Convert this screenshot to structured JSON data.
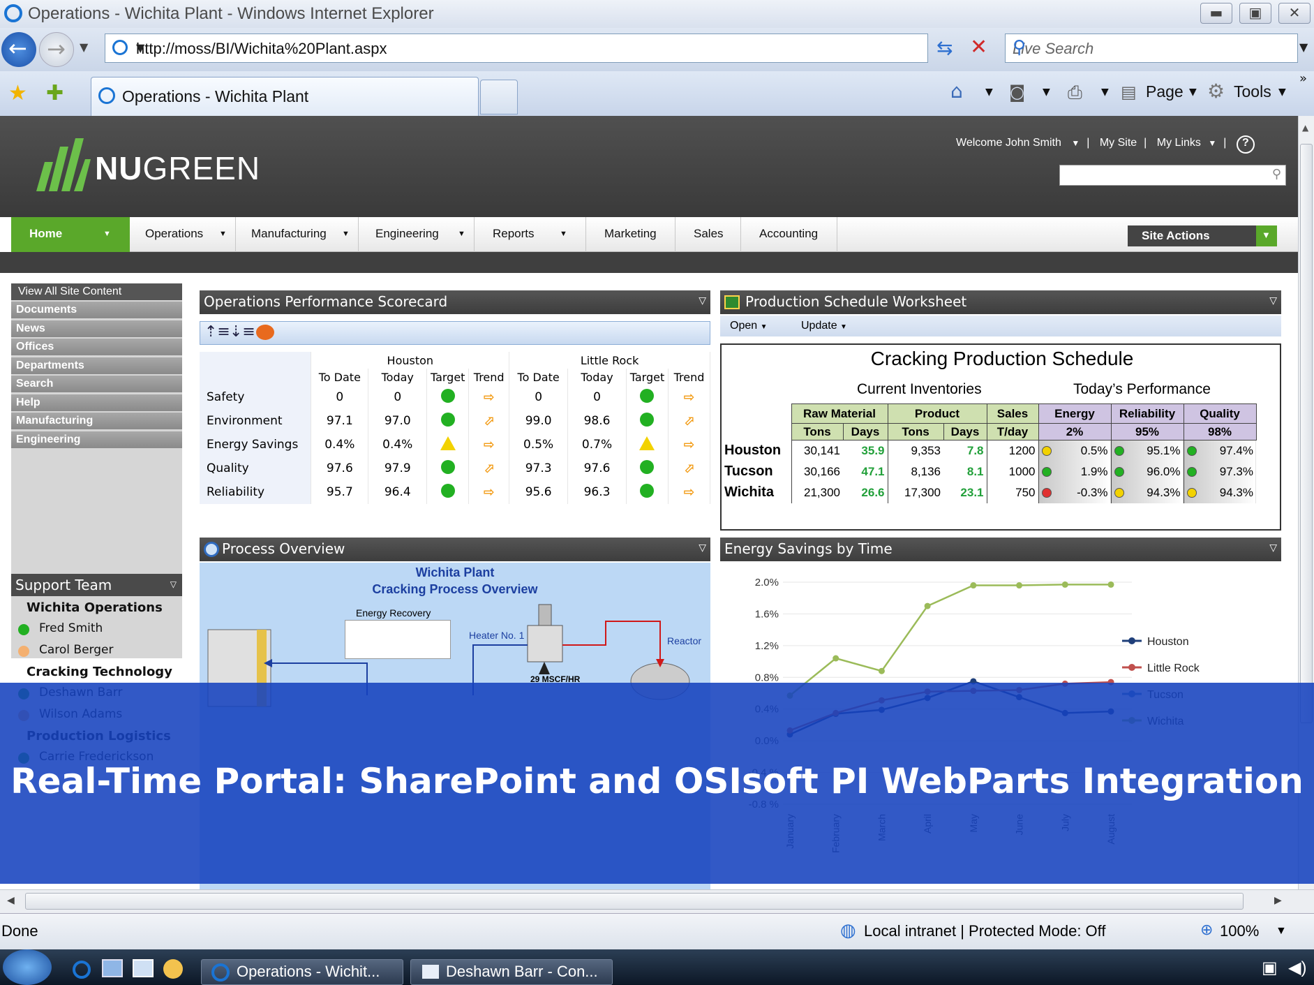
{
  "window": {
    "title": "Operations - Wichita Plant - Windows Internet Explorer"
  },
  "browser": {
    "url": "http://moss/BI/Wichita%20Plant.aspx",
    "search_placeholder": "Live Search",
    "tab_title": "Operations - Wichita Plant",
    "commands": [
      "Page",
      "Tools"
    ]
  },
  "site": {
    "logo_bold": "NU",
    "logo_rest": "GREEN",
    "welcome": "Welcome John Smith",
    "my_site": "My Site",
    "my_links": "My Links",
    "help": "?",
    "nav": [
      "Home",
      "Operations",
      "Manufacturing",
      "Engineering",
      "Reports",
      "Marketing",
      "Sales",
      "Accounting"
    ],
    "site_actions": "Site Actions"
  },
  "quicklaunch": {
    "view_all": "View All Site Content",
    "items": [
      "Documents",
      "News",
      "Offices",
      "Departments",
      "Search",
      "Help",
      "Manufacturing",
      "Engineering"
    ]
  },
  "support_team": {
    "title": "Support Team",
    "groups": [
      {
        "name": "Wichita Operations",
        "people": [
          {
            "name": "Fred Smith",
            "status": "green"
          },
          {
            "name": "Carol Berger",
            "status": "orange"
          }
        ]
      },
      {
        "name": "Cracking Technology",
        "people": [
          {
            "name": "Deshawn Barr",
            "status": "green"
          },
          {
            "name": "Wilson Adams",
            "status": "orange"
          }
        ]
      },
      {
        "name": "Production Logistics",
        "people": [
          {
            "name": "Carrie Frederickson",
            "status": "green"
          }
        ]
      }
    ]
  },
  "scorecard": {
    "title": "Operations Performance Scorecard",
    "regions": [
      "Houston",
      "Little Rock"
    ],
    "columns": [
      "To Date",
      "Today",
      "Target",
      "Trend",
      "To Date",
      "Today",
      "Target",
      "Trend"
    ],
    "rows": [
      {
        "label": "Safety",
        "h_todate": "0",
        "h_today": "0",
        "h_target": "green",
        "h_trend": "right",
        "l_todate": "0",
        "l_today": "0",
        "l_target": "green",
        "l_trend": "right"
      },
      {
        "label": "Environment",
        "h_todate": "97.1",
        "h_today": "97.0",
        "h_target": "green",
        "h_trend": "up",
        "l_todate": "99.0",
        "l_today": "98.6",
        "l_target": "green",
        "l_trend": "up"
      },
      {
        "label": "Energy Savings",
        "h_todate": "0.4%",
        "h_today": "0.4%",
        "h_target": "yellow",
        "h_trend": "right",
        "l_todate": "0.5%",
        "l_today": "0.7%",
        "l_target": "yellow",
        "l_trend": "right"
      },
      {
        "label": "Quality",
        "h_todate": "97.6",
        "h_today": "97.9",
        "h_target": "green",
        "h_trend": "up",
        "l_todate": "97.3",
        "l_today": "97.6",
        "l_target": "green",
        "l_trend": "up"
      },
      {
        "label": "Reliability",
        "h_todate": "95.7",
        "h_today": "96.4",
        "h_target": "green",
        "h_trend": "right",
        "l_todate": "95.6",
        "l_today": "96.3",
        "l_target": "green",
        "l_trend": "right"
      }
    ]
  },
  "worksheet": {
    "title": "Production Schedule Worksheet",
    "menu": [
      "Open",
      "Update"
    ],
    "sheet_title": "Cracking Production Schedule",
    "group1": "Current Inventories",
    "group2": "Today’s Performance",
    "headers": {
      "raw": "Raw Material",
      "product": "Product",
      "sales": "Sales",
      "energy": "Energy",
      "reliability": "Reliability",
      "quality": "Quality"
    },
    "subheaders": {
      "tons": "Tons",
      "days": "Days",
      "tday": "T/day",
      "energy_target": "2%",
      "reliability_target": "95%",
      "quality_target": "98%"
    },
    "rows": [
      {
        "site": "Houston",
        "raw_tons": "30,141",
        "raw_days": "35.9",
        "prod_tons": "9,353",
        "prod_days": "7.8",
        "sales": "1200",
        "energy": "0.5%",
        "energy_ind": "yellow",
        "reliability": "95.1%",
        "reliability_ind": "green",
        "quality": "97.4%",
        "quality_ind": "green"
      },
      {
        "site": "Tucson",
        "raw_tons": "30,166",
        "raw_days": "47.1",
        "prod_tons": "8,136",
        "prod_days": "8.1",
        "sales": "1000",
        "energy": "1.9%",
        "energy_ind": "green",
        "reliability": "96.0%",
        "reliability_ind": "green",
        "quality": "97.3%",
        "quality_ind": "green"
      },
      {
        "site": "Wichita",
        "raw_tons": "21,300",
        "raw_days": "26.6",
        "prod_tons": "17,300",
        "prod_days": "23.1",
        "sales": "750",
        "energy": "-0.3%",
        "energy_ind": "red",
        "reliability": "94.3%",
        "reliability_ind": "yellow",
        "quality": "94.3%",
        "quality_ind": "yellow"
      }
    ]
  },
  "process": {
    "title": "Process Overview",
    "diagram_title_1": "Wichita Plant",
    "diagram_title_2": "Cracking Process Overview",
    "labels": {
      "energy_recovery": "Energy Recovery",
      "heater": "Heater No. 1",
      "reactor": "Reactor",
      "flow": "29 MSCF/HR"
    }
  },
  "chart_data": {
    "type": "line",
    "title": "Energy Savings by Time",
    "ytick_labels": [
      "2.0%",
      "1.6%",
      "1.2%",
      "0.8%",
      "0.4%",
      "0.0%",
      "-0.4 %",
      "-0.8 %"
    ],
    "ylim": [
      -0.8,
      2.0
    ],
    "x": [
      "January",
      "February",
      "March",
      "April",
      "May",
      "June",
      "July",
      "August"
    ],
    "legend_position": "right",
    "series": [
      {
        "name": "Houston",
        "color": "#1f3f7a",
        "values": [
          0.08,
          0.34,
          0.39,
          0.54,
          0.75,
          0.55,
          0.35,
          0.37
        ]
      },
      {
        "name": "Little Rock",
        "color": "#c0504d",
        "values": [
          0.13,
          0.35,
          0.51,
          0.62,
          0.63,
          0.64,
          0.72,
          0.74
        ]
      },
      {
        "name": "Tucson",
        "color": "#4f81bd",
        "values": [
          null,
          null,
          null,
          null,
          null,
          null,
          null,
          null
        ]
      },
      {
        "name": "Wichita",
        "color": "#9bbb59",
        "values": [
          0.57,
          1.04,
          0.88,
          1.7,
          1.96,
          1.96,
          1.97,
          1.97
        ]
      }
    ]
  },
  "overlay": {
    "caption": "Real-Time Portal: SharePoint and OSIsoft PI WebParts Integration"
  },
  "statusbar": {
    "text": "Done",
    "zone": "Local intranet | Protected Mode: Off",
    "zoom": "100%"
  },
  "taskbar": {
    "tasks": [
      "Operations - Wichit...",
      "Deshawn Barr - Con..."
    ]
  }
}
